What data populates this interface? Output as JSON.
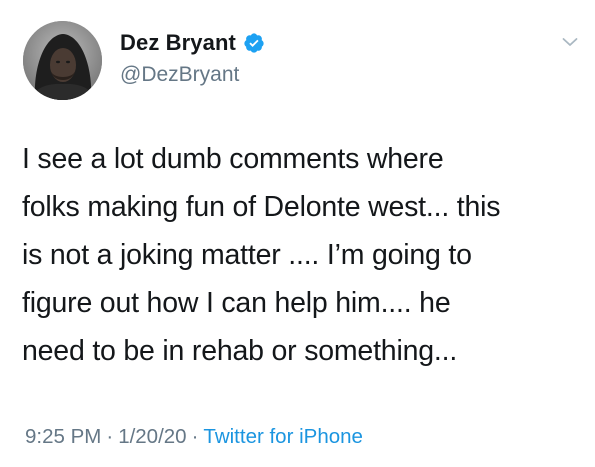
{
  "user": {
    "display_name": "Dez Bryant",
    "handle": "@DezBryant",
    "verified": true
  },
  "tweet": {
    "lines": [
      "I see a lot dumb comments where",
      "folks making fun of Delonte west... this",
      "is not a joking matter .... I’m going to",
      "figure out how I can help him.... he",
      "need to be in rehab or something..."
    ]
  },
  "meta": {
    "time": "9:25 PM",
    "separator": "·",
    "date": "1/20/20",
    "source": "Twitter for iPhone"
  },
  "icons": {
    "verified": "verified-badge-icon",
    "more": "chevron-down-icon"
  },
  "colors": {
    "verified_blue": "#1da1f2",
    "link_blue": "#1b95e0",
    "secondary_text": "#657786",
    "primary_text": "#14171a"
  }
}
